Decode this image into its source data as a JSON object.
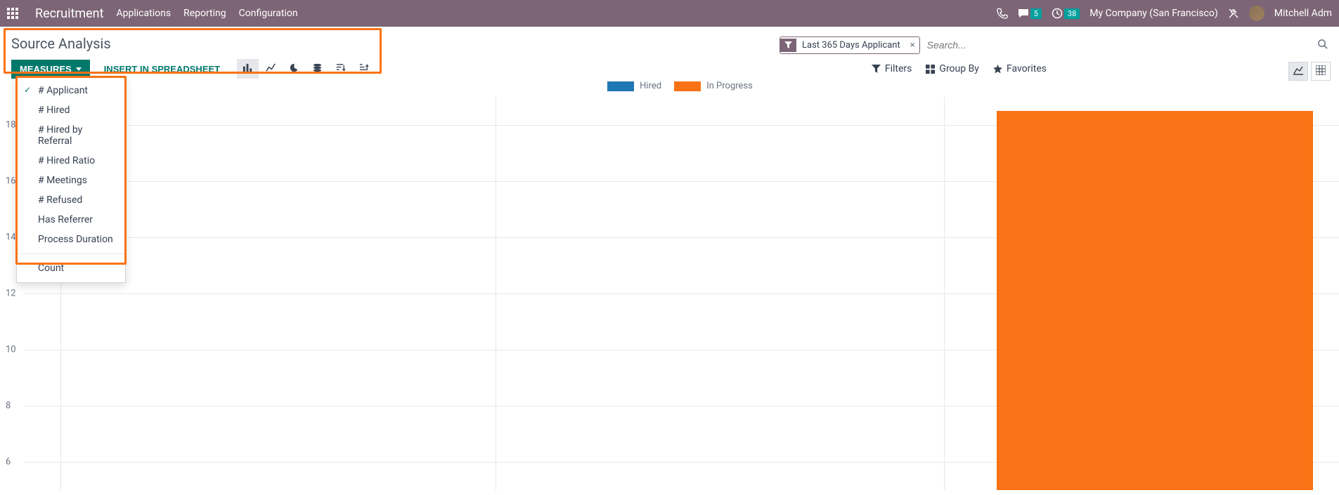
{
  "nav": {
    "app_title": "Recruitment",
    "links": [
      "Applications",
      "Reporting",
      "Configuration"
    ],
    "messages_badge": "5",
    "activities_badge": "38",
    "company": "My Company (San Francisco)",
    "user": "Mitchell Adm"
  },
  "header": {
    "title": "Source Analysis"
  },
  "toolbar": {
    "measures_label": "MEASURES",
    "spreadsheet_label": "INSERT IN SPREADSHEET"
  },
  "measures_dropdown": {
    "items": [
      {
        "label": "# Applicant",
        "checked": true
      },
      {
        "label": "# Hired",
        "checked": false
      },
      {
        "label": "# Hired by Referral",
        "checked": false
      },
      {
        "label": "# Hired Ratio",
        "checked": false
      },
      {
        "label": "# Meetings",
        "checked": false
      },
      {
        "label": "# Refused",
        "checked": false
      },
      {
        "label": "Has Referrer",
        "checked": false
      },
      {
        "label": "Process Duration",
        "checked": false
      }
    ],
    "count_label": "Count"
  },
  "search": {
    "chip_label": "Last 365 Days Applicant",
    "placeholder": "Search..."
  },
  "filters": {
    "filters_label": "Filters",
    "groupby_label": "Group By",
    "favorites_label": "Favorites"
  },
  "chart_data": {
    "type": "bar",
    "legend": [
      {
        "name": "Hired",
        "color": "#1f77b4"
      },
      {
        "name": "In Progress",
        "color": "#f97316"
      }
    ],
    "y_ticks": [
      6,
      8,
      10,
      12,
      14,
      16,
      18
    ],
    "ylim": [
      5,
      19
    ],
    "series": [
      {
        "name": "In Progress",
        "values": [
          18.5
        ],
        "color": "#f97316"
      }
    ],
    "grid_v_positions_pct": [
      3,
      36,
      70
    ],
    "bar_left_pct": 74,
    "bar_width_pct": 24
  }
}
